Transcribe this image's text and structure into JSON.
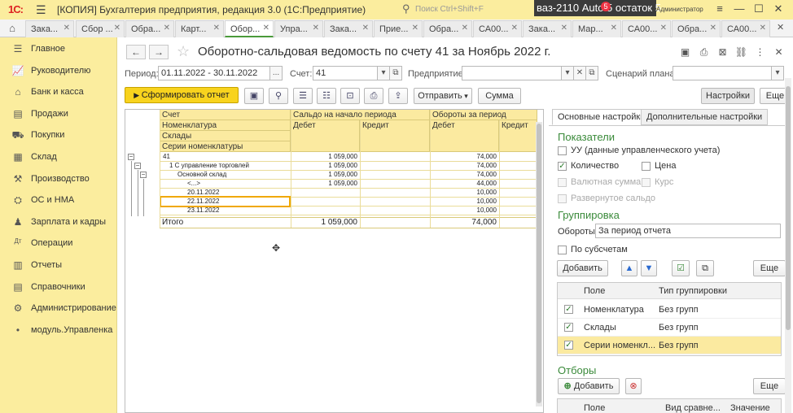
{
  "titlebar": {
    "logo": "1С:",
    "title": "[КОПИЯ] Бухгалтерия предприятия, редакция 3.0  (1С:Предприятие)",
    "search_placeholder": "Поиск Ctrl+Shift+F",
    "overlay_text": "ваз-2110 Auto  5 остаток 5",
    "notification_count": "5",
    "user": "Администратор"
  },
  "tabs": [
    {
      "label": "Зака..."
    },
    {
      "label": "Сбор ..."
    },
    {
      "label": "Обра..."
    },
    {
      "label": "Карт..."
    },
    {
      "label": "Обор..."
    },
    {
      "label": "Упра..."
    },
    {
      "label": "Зака..."
    },
    {
      "label": "Прие..."
    },
    {
      "label": "Обра..."
    },
    {
      "label": "СА00..."
    },
    {
      "label": "Зака..."
    },
    {
      "label": "Мар..."
    },
    {
      "label": "СА00..."
    },
    {
      "label": "Обра..."
    },
    {
      "label": "СА00..."
    }
  ],
  "sidebar": {
    "items": [
      {
        "label": "Главное",
        "icon": "menu-icon"
      },
      {
        "label": "Руководителю",
        "icon": "chart-icon"
      },
      {
        "label": "Банк и касса",
        "icon": "bank-icon"
      },
      {
        "label": "Продажи",
        "icon": "sales-icon"
      },
      {
        "label": "Покупки",
        "icon": "cart-icon"
      },
      {
        "label": "Склад",
        "icon": "warehouse-icon"
      },
      {
        "label": "Производство",
        "icon": "factory-icon"
      },
      {
        "label": "ОС и НМА",
        "icon": "assets-icon"
      },
      {
        "label": "Зарплата и кадры",
        "icon": "person-icon"
      },
      {
        "label": "Операции",
        "icon": "operations-icon"
      },
      {
        "label": "Отчеты",
        "icon": "reports-icon"
      },
      {
        "label": "Справочники",
        "icon": "book-icon"
      },
      {
        "label": "Администрирование",
        "icon": "gear-icon"
      },
      {
        "label": "модуль.Управленка",
        "icon": "dot-icon"
      }
    ]
  },
  "form": {
    "title": "Оборотно-сальдовая ведомость по счету 41 за Ноябрь 2022 г.",
    "period_label": "Период:",
    "period_value": "01.11.2022 - 30.11.2022",
    "period_btn": "...",
    "account_label": "Счет:",
    "account_value": "41",
    "enterprise_label": "Предприятие:",
    "enterprise_value": "",
    "scenario_label": "Сценарий плана:",
    "scenario_value": "",
    "generate_btn": "Сформировать отчет",
    "send_btn": "Отправить",
    "sum_btn": "Сумма",
    "settings_btn": "Настройки",
    "more_btn": "Еще"
  },
  "report": {
    "headers": {
      "account": "Счет",
      "nomenclature": "Номенклатура",
      "warehouses": "Склады",
      "series": "Серии номенклатуры",
      "opening_balance": "Сальдо на начало периода",
      "turnover": "Обороты за период",
      "debit": "Дебет",
      "credit": "Кредит"
    },
    "rows": [
      {
        "name": "41",
        "open_debit": "1 059,000",
        "turn_debit": "74,000"
      },
      {
        "name": "1 С управление торговлей",
        "open_debit": "1 059,000",
        "turn_debit": "74,000"
      },
      {
        "name": "Основной склад",
        "open_debit": "1 059,000",
        "turn_debit": "74,000"
      },
      {
        "name": "<...>",
        "open_debit": "1 059,000",
        "turn_debit": "44,000"
      },
      {
        "name": "20.11.2022",
        "open_debit": "",
        "turn_debit": "10,000"
      },
      {
        "name": "22.11.2022",
        "open_debit": "",
        "turn_debit": "10,000"
      },
      {
        "name": "23.11.2022",
        "open_debit": "",
        "turn_debit": "10,000"
      }
    ],
    "total_label": "Итого",
    "total_open_debit": "1 059,000",
    "total_turn_debit": "74,000"
  },
  "settings": {
    "tab_main": "Основные настройки",
    "tab_extra": "Дополнительные настройки",
    "indicators_title": "Показатели",
    "chk_uu": "УУ (данные управленческого учета)",
    "chk_quantity": "Количество",
    "chk_price": "Цена",
    "chk_currency": "Валютная сумма",
    "chk_rate": "Курс",
    "chk_expanded": "Развернутое сальдо",
    "grouping_title": "Группировка",
    "turnover_label": "Обороты:",
    "turnover_value": "За период отчета",
    "chk_subaccounts": "По субсчетам",
    "add_btn": "Добавить",
    "more_btn": "Еще",
    "col_field": "Поле",
    "col_group_type": "Тип группировки",
    "group_rows": [
      {
        "field": "Номенклатура",
        "type": "Без групп"
      },
      {
        "field": "Склады",
        "type": "Без групп"
      },
      {
        "field": "Серии номенкл...",
        "type": "Без групп"
      }
    ],
    "filters_title": "Отборы",
    "filters_add_btn": "Добавить",
    "filters_more_btn": "Еще",
    "filters_col_field": "Поле",
    "filters_col_compare": "Вид сравне...",
    "filters_col_value": "Значение"
  }
}
